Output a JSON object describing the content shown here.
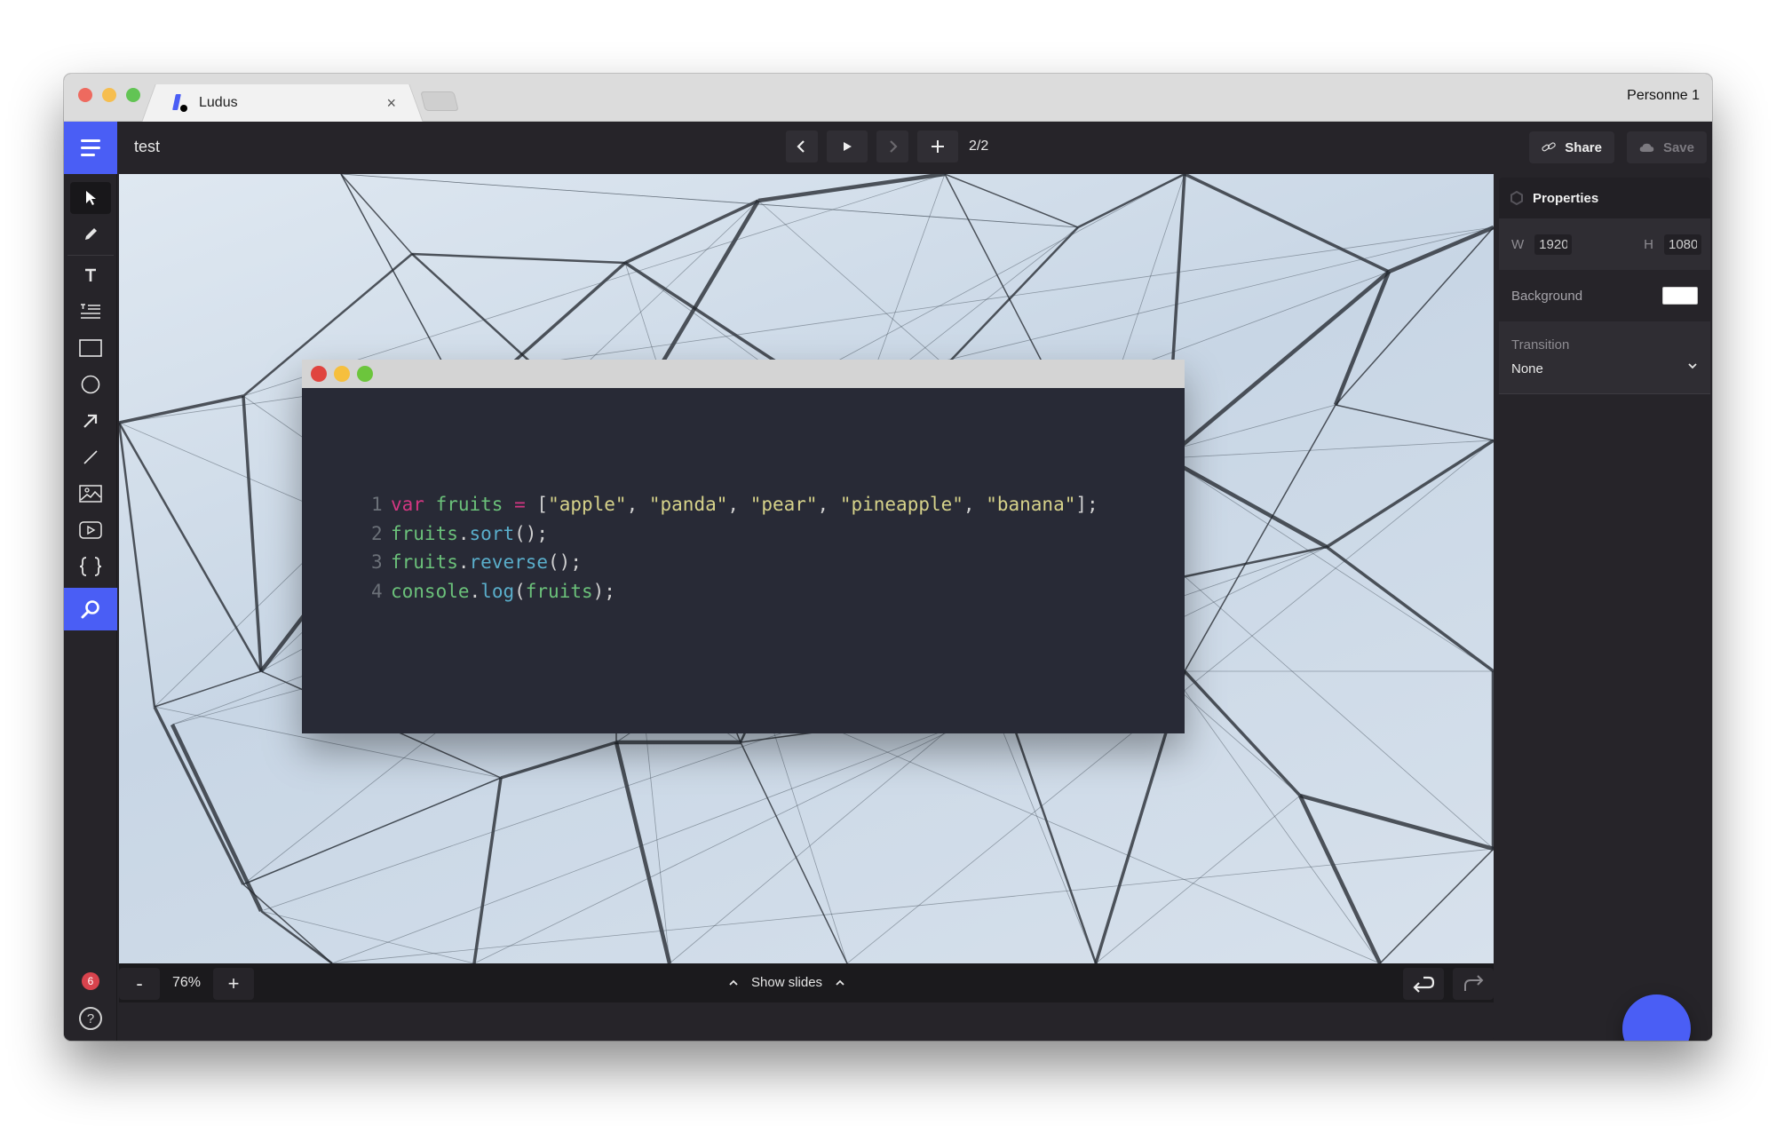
{
  "browser": {
    "tab_title": "Ludus",
    "tab_close": "×",
    "profile": "Personne 1"
  },
  "header": {
    "menu_icon": "hamburger-icon",
    "doc_title": "test",
    "nav": {
      "prev_icon": "chevron-left-icon",
      "play_icon": "play-icon",
      "next_icon": "chevron-right-icon",
      "add_icon": "plus-icon",
      "page_count": "2/2"
    },
    "share_label": "Share",
    "save_label": "Save"
  },
  "toolbar": {
    "tools": [
      {
        "name": "select",
        "icon": "cursor-icon",
        "active": true
      },
      {
        "name": "pen",
        "icon": "pencil-icon"
      },
      {
        "name": "text",
        "icon": "text-icon",
        "glyph": "T"
      },
      {
        "name": "paragraph",
        "icon": "paragraph-icon"
      },
      {
        "name": "rectangle",
        "icon": "rectangle-icon"
      },
      {
        "name": "ellipse",
        "icon": "circle-icon"
      },
      {
        "name": "arrow",
        "icon": "arrow-icon"
      },
      {
        "name": "line",
        "icon": "line-icon"
      },
      {
        "name": "image",
        "icon": "image-icon"
      },
      {
        "name": "video",
        "icon": "video-icon"
      },
      {
        "name": "code",
        "icon": "code-braces-icon",
        "glyph": "{ }"
      },
      {
        "name": "search",
        "icon": "search-icon"
      }
    ],
    "notification_count": "6",
    "help_glyph": "?"
  },
  "canvas": {
    "code_block": {
      "lines": [
        {
          "n": "1",
          "tokens": [
            [
              "kw",
              "var"
            ],
            [
              "pun",
              " "
            ],
            [
              "var",
              "fruits"
            ],
            [
              "pun",
              " "
            ],
            [
              "op",
              "="
            ],
            [
              "pun",
              " ["
            ],
            [
              "str",
              "\"apple\""
            ],
            [
              "pun",
              ", "
            ],
            [
              "str",
              "\"panda\""
            ],
            [
              "pun",
              ", "
            ],
            [
              "str",
              "\"pear\""
            ],
            [
              "pun",
              ", "
            ],
            [
              "str",
              "\"pineapple\""
            ],
            [
              "pun",
              ", "
            ],
            [
              "str",
              "\"banana\""
            ],
            [
              "pun",
              "];"
            ]
          ]
        },
        {
          "n": "2",
          "tokens": [
            [
              "var",
              "fruits"
            ],
            [
              "pun",
              "."
            ],
            [
              "fn",
              "sort"
            ],
            [
              "pun",
              "();"
            ]
          ]
        },
        {
          "n": "3",
          "tokens": [
            [
              "var",
              "fruits"
            ],
            [
              "pun",
              "."
            ],
            [
              "fn",
              "reverse"
            ],
            [
              "pun",
              "();"
            ]
          ]
        },
        {
          "n": "4",
          "tokens": [
            [
              "var",
              "console"
            ],
            [
              "pun",
              "."
            ],
            [
              "fn",
              "log"
            ],
            [
              "pun",
              "("
            ],
            [
              "var",
              "fruits"
            ],
            [
              "pun",
              ");"
            ]
          ]
        }
      ]
    }
  },
  "bottombar": {
    "zoom_minus": "-",
    "zoom_value": "76%",
    "zoom_plus": "+",
    "show_slides": "Show slides"
  },
  "properties": {
    "title": "Properties",
    "width_label": "W",
    "width_value": "1920",
    "height_label": "H",
    "height_value": "1080",
    "background_label": "Background",
    "background_color": "#ffffff",
    "transition_label": "Transition",
    "transition_value": "None"
  },
  "colors": {
    "accent": "#4a5ef5",
    "badge": "#d8434d"
  }
}
